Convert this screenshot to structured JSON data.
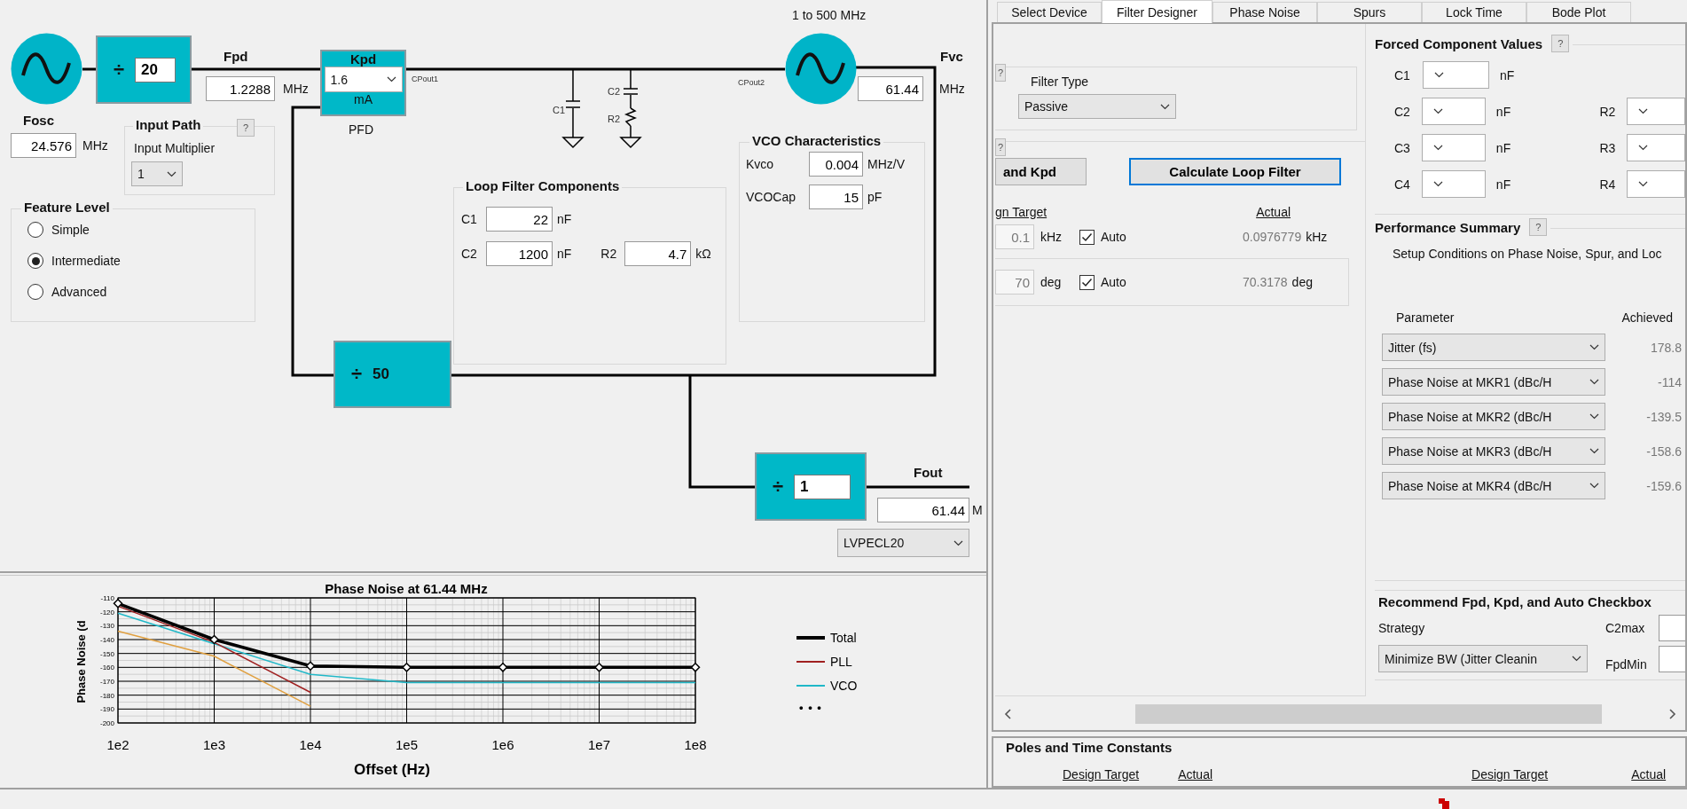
{
  "diagram": {
    "reference_divider": {
      "symbol": "÷",
      "value": "20"
    },
    "fpd": {
      "label": "Fpd",
      "value": "1.2288",
      "unit": "MHz"
    },
    "pfd": {
      "title": "Kpd",
      "value": "1.6",
      "unit": "mA",
      "label": "PFD"
    },
    "pins": [
      "CPout1",
      "CPout2"
    ],
    "fosc": {
      "label": "Fosc",
      "value": "24.576",
      "unit": "MHz"
    },
    "input_path": {
      "title": "Input Path",
      "help": "?",
      "label": "Input Multiplier",
      "value": "1"
    },
    "feature_level": {
      "title": "Feature Level",
      "options": [
        {
          "label": "Simple",
          "selected": false
        },
        {
          "label": "Intermediate",
          "selected": true
        },
        {
          "label": "Advanced",
          "selected": false
        }
      ]
    },
    "filter_labels": [
      "C1",
      "C2",
      "R2"
    ],
    "vco": {
      "range": "1 to 500 MHz",
      "label": "Fvc",
      "value": "61.44",
      "unit": "MHz"
    },
    "loop_filter": {
      "title": "Loop Filter Components",
      "fields": [
        {
          "label": "C1",
          "value": "22",
          "unit": "nF"
        },
        {
          "label": "C2",
          "value": "1200",
          "unit": "nF"
        },
        {
          "label": "R2",
          "value": "4.7",
          "unit": "kΩ"
        }
      ]
    },
    "vco_characteristics": {
      "title": "VCO Characteristics",
      "fields": [
        {
          "label": "Kvco",
          "value": "0.004",
          "unit": "MHz/V"
        },
        {
          "label": "VCOCap",
          "value": "15",
          "unit": "pF"
        }
      ]
    },
    "n_divider": {
      "symbol": "÷",
      "value": "50"
    },
    "output_divider": {
      "symbol": "÷",
      "value": "1"
    },
    "fout": {
      "label": "Fout",
      "value": "61.44",
      "unit": "M",
      "format": "LVPECL20"
    }
  },
  "chart_data": {
    "type": "line",
    "title": "Phase Noise at 61.44 MHz",
    "xlabel": "Offset (Hz)",
    "ylabel": "Phase Noise (d",
    "categories": [
      "1e2",
      "1e3",
      "1e4",
      "1e5",
      "1e6",
      "1e7",
      "1e8"
    ],
    "ylim": [
      -200,
      -110
    ],
    "grid": true,
    "legend": true,
    "yticks": [
      -110,
      -120,
      -130,
      -140,
      -150,
      -160,
      -170,
      -180,
      -190,
      -200
    ],
    "series": [
      {
        "name": "Total",
        "color": "#000000",
        "marker": "diamond",
        "values": [
          -114,
          -140,
          -159,
          -160,
          -160,
          -160,
          -160
        ]
      },
      {
        "name": "PLL",
        "color": "#a02020",
        "values": [
          -116,
          -142,
          -178,
          null,
          null,
          null,
          null
        ]
      },
      {
        "name": "VCO",
        "color": "#20b8c8",
        "values": [
          -121,
          -143,
          -165,
          -171,
          -171,
          -171,
          -171
        ]
      },
      {
        "color": "#e0a040",
        "values": [
          -134,
          -152,
          -188,
          null,
          null,
          null,
          null
        ]
      }
    ]
  },
  "chart_legend": {
    "more": "• • •"
  },
  "tabs": [
    {
      "label": "Select Device",
      "selected": false
    },
    {
      "label": "Filter Designer",
      "selected": true
    },
    {
      "label": "Phase Noise",
      "selected": false
    },
    {
      "label": "Spurs",
      "selected": false
    },
    {
      "label": "Lock Time",
      "selected": false
    },
    {
      "label": "Bode Plot",
      "selected": false
    }
  ],
  "filter_designer": {
    "filter_type": {
      "help": "?",
      "label": "Filter Type",
      "value": "Passive"
    },
    "design": {
      "help": "?",
      "kpd_button": "and Kpd",
      "calculate_button": "Calculate Loop Filter",
      "target_header": "gn Target",
      "actual_header": "Actual",
      "rows": [
        {
          "value": "0.1",
          "unit": "kHz",
          "auto_label": "Auto",
          "checked": true,
          "disabled": true,
          "actual": "0.0976779",
          "actual_unit": "kHz"
        },
        {
          "value": "70",
          "unit": "deg",
          "auto_label": "Auto",
          "checked": true,
          "disabled": true,
          "actual": "70.3178",
          "actual_unit": "deg"
        }
      ]
    },
    "forced": {
      "title": "Forced Component Values",
      "help": "?",
      "rows": [
        {
          "c_label": "C1",
          "unit": "nF"
        },
        {
          "c_label": "C2",
          "unit": "nF",
          "r_label": "R2"
        },
        {
          "c_label": "C3",
          "unit": "nF",
          "r_label": "R3"
        },
        {
          "c_label": "C4",
          "unit": "nF",
          "r_label": "R4"
        }
      ]
    },
    "performance": {
      "title": "Performance Summary",
      "help": "?",
      "setup": "Setup Conditions on Phase Noise, Spur, and Loc",
      "parameter_header": "Parameter",
      "achieved_header": "Achieved",
      "rows": [
        {
          "parameter": "Jitter (fs)",
          "achieved": "178.8"
        },
        {
          "parameter": "Phase Noise at MKR1 (dBc/H",
          "achieved": "-114"
        },
        {
          "parameter": "Phase Noise at MKR2 (dBc/H",
          "achieved": "-139.5"
        },
        {
          "parameter": "Phase Noise at MKR3 (dBc/H",
          "achieved": "-158.6"
        },
        {
          "parameter": "Phase Noise at MKR4 (dBc/H",
          "achieved": "-159.6"
        }
      ]
    },
    "recommend": {
      "title": "Recommend Fpd, Kpd, and Auto Checkbox",
      "strategy_label": "Strategy",
      "strategy": "Minimize BW (Jitter Cleanin",
      "c2max_label": "C2max",
      "fpdmin_label": "FpdMin"
    }
  },
  "poles": {
    "title": "Poles and Time Constants",
    "headers": [
      "Design Target",
      "Actual",
      "Design Target",
      "Actual"
    ]
  }
}
